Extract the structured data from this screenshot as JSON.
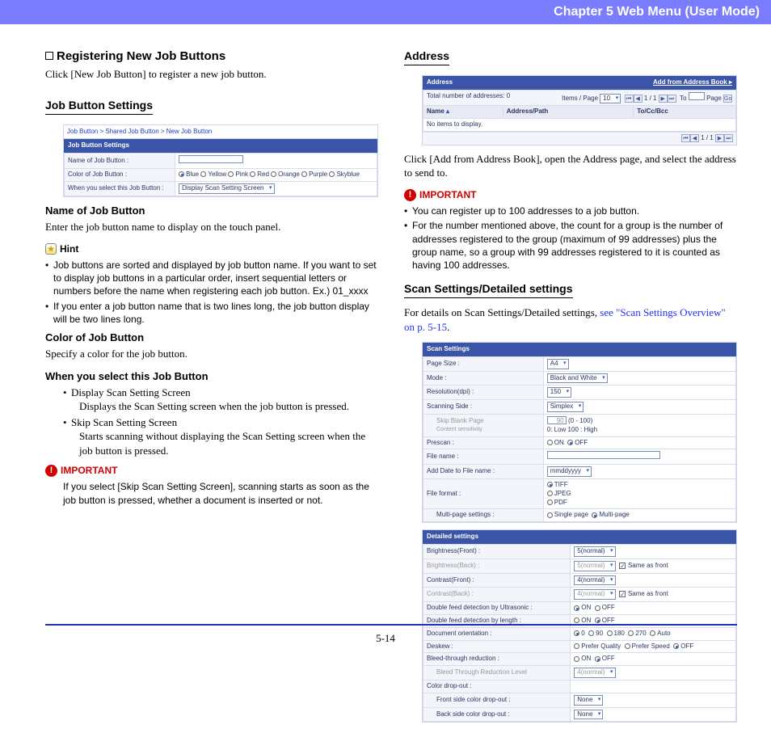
{
  "header": {
    "chapter_label": "Chapter 5   Web Menu (User Mode)"
  },
  "footer": {
    "page": "5-14"
  },
  "left": {
    "section_title": "Registering New Job Buttons",
    "section_intro": "Click [New Job Button] to register a new job button.",
    "job_button_settings_h": "Job Button Settings",
    "mock1": {
      "breadcrumb": "Job Button > Shared Job Button > New Job Button",
      "bar": "Job Button Settings",
      "rows": {
        "name_l": "Name of Job Button :",
        "color_l": "Color of Job Button :",
        "color_opts": [
          "Blue",
          "Yellow",
          "Pink",
          "Red",
          "Orange",
          "Purple",
          "Skyblue"
        ],
        "when_l": "When you select this Job Button :",
        "when_v": "Display Scan Setting Screen"
      }
    },
    "name_h": "Name of Job Button",
    "name_p": "Enter the job button name to display on the touch panel.",
    "hint_label": "Hint",
    "hints": [
      "Job buttons are sorted and displayed by job button name. If you want to set to display job buttons in a particular order, insert sequential letters or numbers before the name when registering each job button. Ex.) 01_xxxx",
      "If you enter a job button name that is two lines long, the job button display will be two lines long."
    ],
    "color_h": "Color of Job Button",
    "color_p": "Specify a color for the job button.",
    "when_h": "When you select this Job Button",
    "when_items": [
      {
        "t": "Display Scan Setting Screen",
        "d": "Displays the Scan Setting screen when the job button is pressed."
      },
      {
        "t": "Skip Scan Setting Screen",
        "d": "Starts scanning without displaying the Scan Setting screen when the job button is pressed."
      }
    ],
    "important_label": "IMPORTANT",
    "important_p": "If you select [Skip Scan Setting Screen], scanning starts as soon as the job button is pressed, whether a document is inserted or not."
  },
  "right": {
    "address_h": "Address",
    "mock2": {
      "bar": "Address",
      "bar_link": "Add from Address Book",
      "total": "Total number of addresses: 0",
      "items_page_l": "Items / Page",
      "items_page_v": "10",
      "pager": "1 / 1",
      "to_l": "To",
      "page_l": "Page",
      "go": "Go",
      "hdr_name": "Name",
      "hdr_addr": "Address/Path",
      "hdr_to": "To/Cc/Bcc",
      "empty": "No items to display."
    },
    "address_p": "Click [Add from Address Book], open the Address page, and select the address to send to.",
    "important_label": "IMPORTANT",
    "important_items": [
      "You can register up to 100 addresses to a job button.",
      "For the number mentioned above, the count for a group is the number of addresses registered to the group (maximum of 99 addresses) plus the group name, so a group with 99 addresses registered to it is counted as having 100 addresses."
    ],
    "scan_h": "Scan Settings/Detailed settings",
    "scan_p_pre": "For details on Scan Settings/Detailed settings, ",
    "scan_link": "see \"Scan Settings Overview\" on p. 5-15",
    "mock3a": {
      "bar": "Scan Settings",
      "pagesize_l": "Page Size :",
      "pagesize_v": "A4",
      "mode_l": "Mode :",
      "mode_v": "Black and White",
      "res_l": "Resolution(dpi) :",
      "res_v": "150",
      "side_l": "Scanning Side :",
      "side_v": "Simplex",
      "skip_l": "Skip Blank Page",
      "skip_sub": "Content sensitivity",
      "skip_range": "(0 - 100)",
      "skip_hint": "0: Low  100 : High",
      "skip_v": "90",
      "prescan_l": "Prescan :",
      "on": "ON",
      "off": "OFF",
      "fname_l": "File name :",
      "adddate_l": "Add Date to File name :",
      "adddate_v": "mmddyyyy",
      "fmt_l": "File format :",
      "fmt_opts": [
        "TIFF",
        "JPEG",
        "PDF"
      ],
      "multi_l": "Multi-page settings :",
      "multi_opts": [
        "Single page",
        "Multi-page"
      ]
    },
    "mock3b": {
      "bar": "Detailed settings",
      "bf_l": "Brightness(Front) :",
      "bf_v": "5(normal)",
      "bb_l": "Brightness(Back) :",
      "bb_v": "5(normal)",
      "same": "Same as front",
      "cf_l": "Contrast(Front) :",
      "cf_v": "4(normal)",
      "cb_l": "Contrast(Back) :",
      "cb_v": "4(normal)",
      "dfu_l": "Double feed detection by Ultrasonic :",
      "dfl_l": "Double feed detection by length :",
      "ori_l": "Document orientation :",
      "ori_opts": [
        "0",
        "90",
        "180",
        "270",
        "Auto"
      ],
      "des_l": "Deskew :",
      "des_opts": [
        "Prefer Quality",
        "Prefer Speed",
        "OFF"
      ],
      "bt_l": "Bleed-through reduction :",
      "btlvl_l": "Bleed Through Reduction Level",
      "btlvl_v": "4(normal)",
      "cdo_l": "Color drop-out :",
      "fcd_l": "Front side color drop-out :",
      "fcd_v": "None",
      "bcd_l": "Back side color drop-out :",
      "bcd_v": "None",
      "on": "ON",
      "off": "OFF"
    }
  }
}
